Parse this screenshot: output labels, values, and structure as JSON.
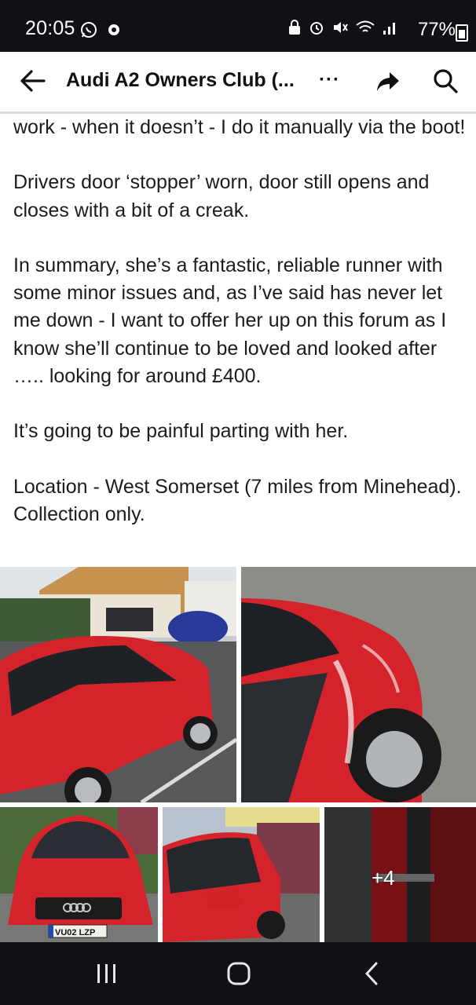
{
  "status_bar": {
    "time": "20:05",
    "battery": "77%"
  },
  "header": {
    "title": "Audi A2 Owners Club (...",
    "more_label": "···"
  },
  "post": {
    "paragraphs": [
      "work - when it doesn’t - I do it manually via the boot!",
      "Drivers door ‘stopper’ worn, door still opens and closes with a bit of a creak.",
      "In summary, she’s a fantastic, reliable runner with some minor issues and, as I’ve said has never let me down - I want to offer her up on this forum as I know she’ll continue to be loved and looked after ….. looking for around £400.",
      "It’s going to be painful parting with her.",
      "Location - West Somerset (7 miles from Minehead). Collection only."
    ]
  },
  "photos": {
    "plate": "VU02 LZP",
    "more_count": "+4"
  },
  "colors": {
    "status_bg": "#0f1115",
    "car_red": "#d4232b"
  }
}
